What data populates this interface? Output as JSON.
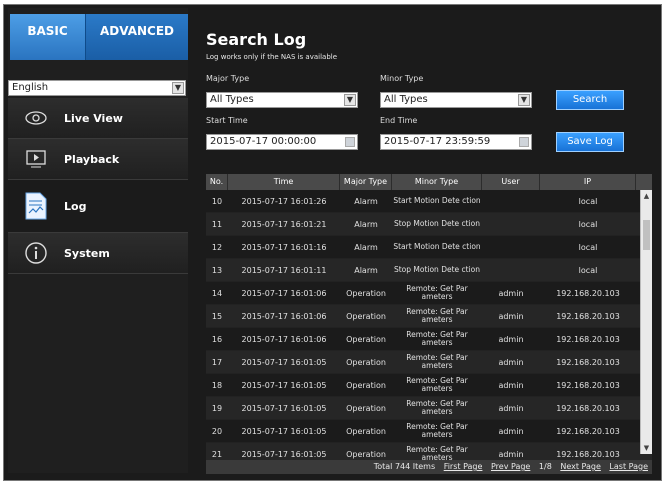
{
  "sidebar": {
    "tabs": [
      "BASIC",
      "ADVANCED"
    ],
    "language": "English",
    "items": [
      {
        "label": "Live View",
        "icon": "eye-icon"
      },
      {
        "label": "Playback",
        "icon": "play-icon"
      },
      {
        "label": "Log",
        "icon": "document-icon"
      },
      {
        "label": "System",
        "icon": "info-icon"
      }
    ]
  },
  "main": {
    "title": "Search Log",
    "subtitle": "Log works only if the NAS is available",
    "major_type_label": "Major Type",
    "major_type_value": "All Types",
    "minor_type_label": "Minor Type",
    "minor_type_value": "All Types",
    "start_time_label": "Start Time",
    "start_time_value": "2015-07-17 00:00:00",
    "end_time_label": "End Time",
    "end_time_value": "2015-07-17 23:59:59",
    "search_button": "Search",
    "save_button": "Save Log"
  },
  "table": {
    "columns": [
      "No.",
      "Time",
      "Major Type",
      "Minor Type",
      "User",
      "IP"
    ],
    "rows": [
      {
        "no": "10",
        "time": "2015-07-17 16:01:26",
        "major": "Alarm",
        "minor": "Start Motion Dete ction",
        "user": "",
        "ip": "local"
      },
      {
        "no": "11",
        "time": "2015-07-17 16:01:21",
        "major": "Alarm",
        "minor": "Stop Motion Dete ction",
        "user": "",
        "ip": "local"
      },
      {
        "no": "12",
        "time": "2015-07-17 16:01:16",
        "major": "Alarm",
        "minor": "Start Motion Dete ction",
        "user": "",
        "ip": "local"
      },
      {
        "no": "13",
        "time": "2015-07-17 16:01:11",
        "major": "Alarm",
        "minor": "Stop Motion Dete ction",
        "user": "",
        "ip": "local"
      },
      {
        "no": "14",
        "time": "2015-07-17 16:01:06",
        "major": "Operation",
        "minor": "Remote: Get Par ameters",
        "user": "admin",
        "ip": "192.168.20.103"
      },
      {
        "no": "15",
        "time": "2015-07-17 16:01:06",
        "major": "Operation",
        "minor": "Remote: Get Par ameters",
        "user": "admin",
        "ip": "192.168.20.103"
      },
      {
        "no": "16",
        "time": "2015-07-17 16:01:06",
        "major": "Operation",
        "minor": "Remote: Get Par ameters",
        "user": "admin",
        "ip": "192.168.20.103"
      },
      {
        "no": "17",
        "time": "2015-07-17 16:01:05",
        "major": "Operation",
        "minor": "Remote: Get Par ameters",
        "user": "admin",
        "ip": "192.168.20.103"
      },
      {
        "no": "18",
        "time": "2015-07-17 16:01:05",
        "major": "Operation",
        "minor": "Remote: Get Par ameters",
        "user": "admin",
        "ip": "192.168.20.103"
      },
      {
        "no": "19",
        "time": "2015-07-17 16:01:05",
        "major": "Operation",
        "minor": "Remote: Get Par ameters",
        "user": "admin",
        "ip": "192.168.20.103"
      },
      {
        "no": "20",
        "time": "2015-07-17 16:01:05",
        "major": "Operation",
        "minor": "Remote: Get Par ameters",
        "user": "admin",
        "ip": "192.168.20.103"
      },
      {
        "no": "21",
        "time": "2015-07-17 16:01:05",
        "major": "Operation",
        "minor": "Remote: Get Par ameters",
        "user": "admin",
        "ip": "192.168.20.103"
      }
    ],
    "pager": {
      "total": "Total 744 Items",
      "first": "First Page",
      "prev": "Prev Page",
      "page": "1/8",
      "next": "Next Page",
      "last": "Last Page"
    }
  },
  "colors": {
    "accent": "#1f72d4",
    "background": "#1b1b1b"
  }
}
